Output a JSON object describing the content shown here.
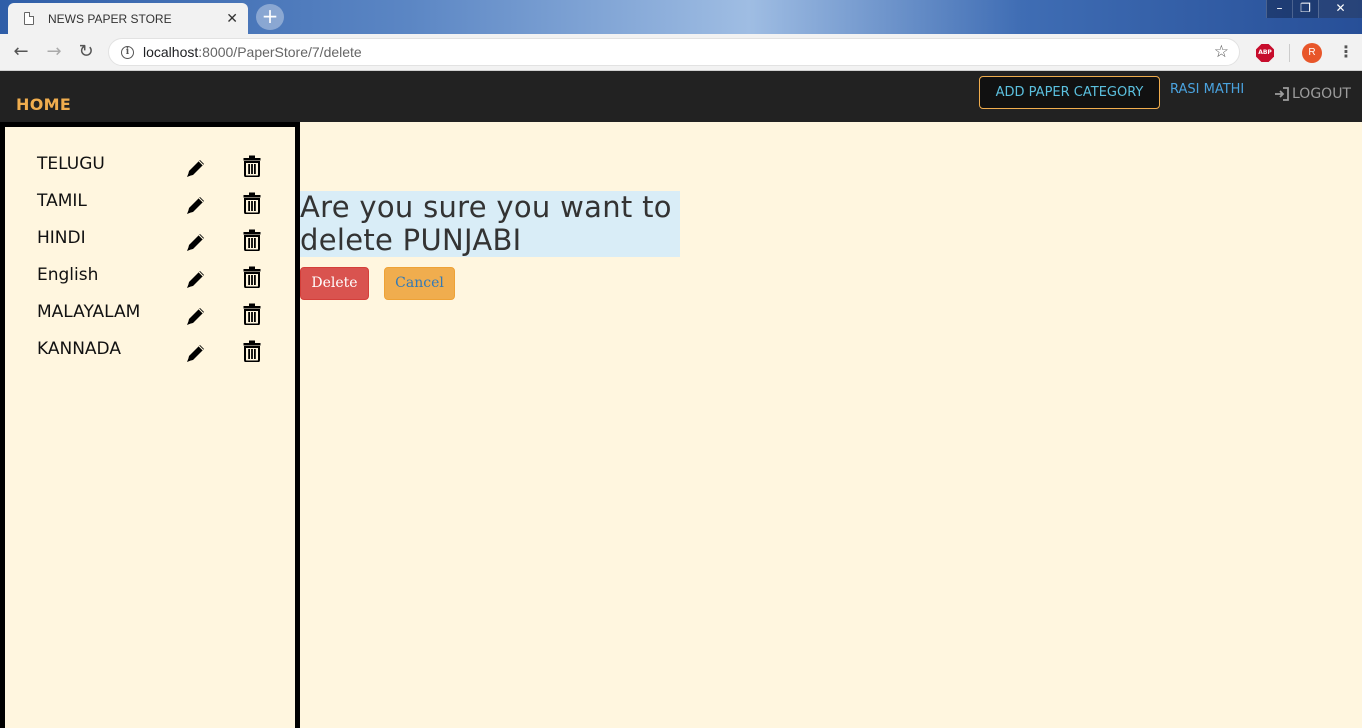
{
  "browser": {
    "tab_title": "NEWS PAPER STORE",
    "tab_close": "✕",
    "new_tab": "+",
    "url_host": "localhost",
    "url_path": ":8000/PaperStore/7/delete",
    "window_controls": [
      "–",
      "❐",
      "✕"
    ],
    "profile_initial": "R",
    "extension_label": "ABP"
  },
  "navbar": {
    "brand": "HOME",
    "add_category": "ADD PAPER CATEGORY",
    "user": "RASI MATHI",
    "logout": "LOGOUT"
  },
  "sidebar": {
    "categories": [
      {
        "label": "TELUGU"
      },
      {
        "label": "TAMIL"
      },
      {
        "label": "HINDI"
      },
      {
        "label": "English"
      },
      {
        "label": "MALAYALAM"
      },
      {
        "label": "KANNADA"
      }
    ]
  },
  "main": {
    "confirm_line1": "Are you sure you want to",
    "confirm_line2": "delete PUNJABI",
    "delete_label": "Delete",
    "cancel_label": "Cancel"
  },
  "colors": {
    "navbar_bg": "#222222",
    "brand": "#f0ad4e",
    "page_bg": "#fff6df",
    "delete_btn": "#d9534f",
    "cancel_btn": "#f0ad4e",
    "confirm_bg": "#d9edf7"
  }
}
